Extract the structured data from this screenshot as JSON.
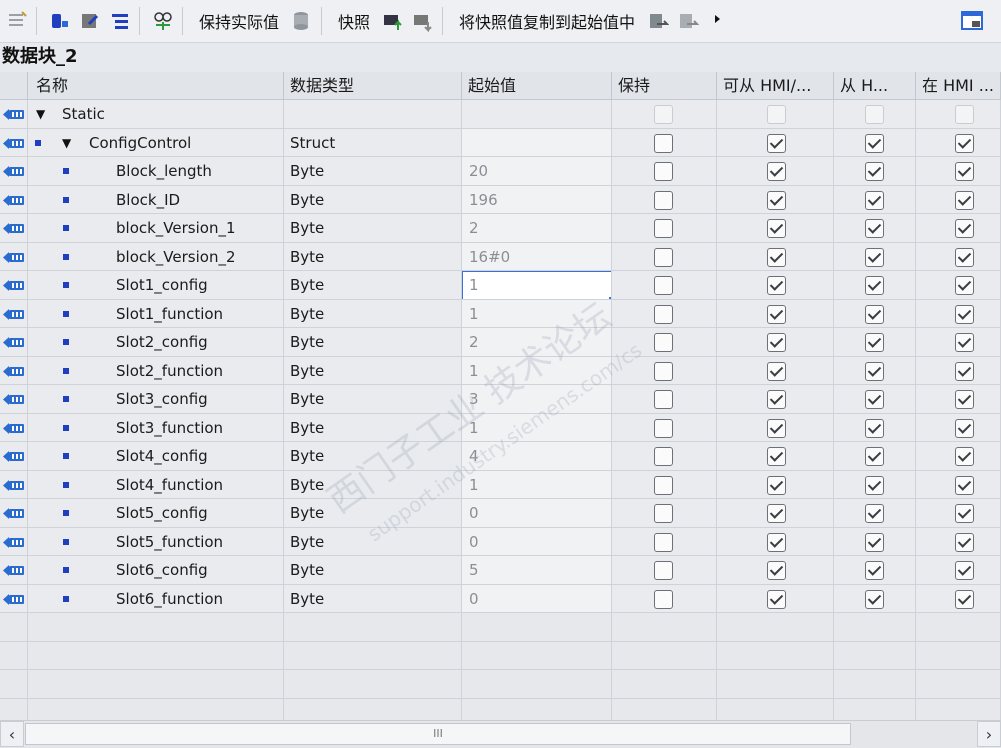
{
  "toolbar": {
    "keep_actual": "保持实际值",
    "snapshot": "快照",
    "copy_snapshot": "将快照值复制到起始值中"
  },
  "block_title": "数据块_2",
  "columns": {
    "name": "名称",
    "datatype": "数据类型",
    "start": "起始值",
    "retain": "保持",
    "accessible_hmi": "可从 HMI/...",
    "writable_hmi": "从 H...",
    "visible_hmi": "在 HMI ..."
  },
  "rows": [
    {
      "name": "Static",
      "type": "",
      "start": ""
    },
    {
      "name": "ConfigControl",
      "type": "Struct",
      "start": ""
    },
    {
      "name": "Block_length",
      "type": "Byte",
      "start": "20"
    },
    {
      "name": "Block_ID",
      "type": "Byte",
      "start": "196"
    },
    {
      "name": "block_Version_1",
      "type": "Byte",
      "start": "2"
    },
    {
      "name": "block_Version_2",
      "type": "Byte",
      "start": "16#0"
    },
    {
      "name": "Slot1_config",
      "type": "Byte",
      "start": "1"
    },
    {
      "name": "Slot1_function",
      "type": "Byte",
      "start": "1"
    },
    {
      "name": "Slot2_config",
      "type": "Byte",
      "start": "2"
    },
    {
      "name": "Slot2_function",
      "type": "Byte",
      "start": "1"
    },
    {
      "name": "Slot3_config",
      "type": "Byte",
      "start": "3"
    },
    {
      "name": "Slot3_function",
      "type": "Byte",
      "start": "1"
    },
    {
      "name": "Slot4_config",
      "type": "Byte",
      "start": "4"
    },
    {
      "name": "Slot4_function",
      "type": "Byte",
      "start": "1"
    },
    {
      "name": "Slot5_config",
      "type": "Byte",
      "start": "0"
    },
    {
      "name": "Slot5_function",
      "type": "Byte",
      "start": "0"
    },
    {
      "name": "Slot6_config",
      "type": "Byte",
      "start": "5"
    },
    {
      "name": "Slot6_function",
      "type": "Byte",
      "start": "0"
    }
  ],
  "watermark": "西门子工业 技术论坛",
  "watermark_url": "support.industry.siemens.com/cs",
  "scroll_thumb": "III",
  "icons": [
    "toolbar-icons",
    "interface-icon",
    "expand-triangle-icon",
    "checkbox-icon"
  ],
  "colors": {
    "accent": "#3c6fd8",
    "member": "#1f3fbf"
  }
}
